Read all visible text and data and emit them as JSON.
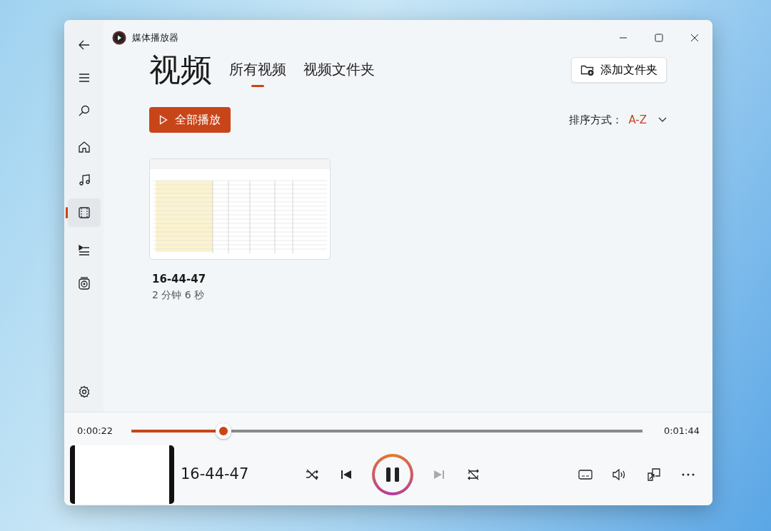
{
  "window": {
    "title": "媒体播放器"
  },
  "nav": [
    {
      "kind": "home",
      "selected": false
    },
    {
      "kind": "music",
      "selected": false
    },
    {
      "kind": "video",
      "selected": true
    },
    {
      "kind": "playlist",
      "selected": false
    },
    {
      "kind": "disc",
      "selected": false
    }
  ],
  "page": {
    "title": "视频",
    "tabs": [
      {
        "label": "所有视频",
        "selected": true
      },
      {
        "label": "视频文件夹",
        "selected": false
      }
    ],
    "add_folder": "添加文件夹",
    "play_all": "全部播放",
    "sort_label": "排序方式：",
    "sort_value": "A-Z"
  },
  "videos": [
    {
      "title": "16-44-47",
      "duration": "2 分钟 6 秒"
    }
  ],
  "player": {
    "elapsed": "0:00:22",
    "total": "0:01:44",
    "level": 0.18,
    "title": "16-44-47",
    "playing": true,
    "shuffle": false,
    "repeat": false,
    "next_disabled": true
  }
}
